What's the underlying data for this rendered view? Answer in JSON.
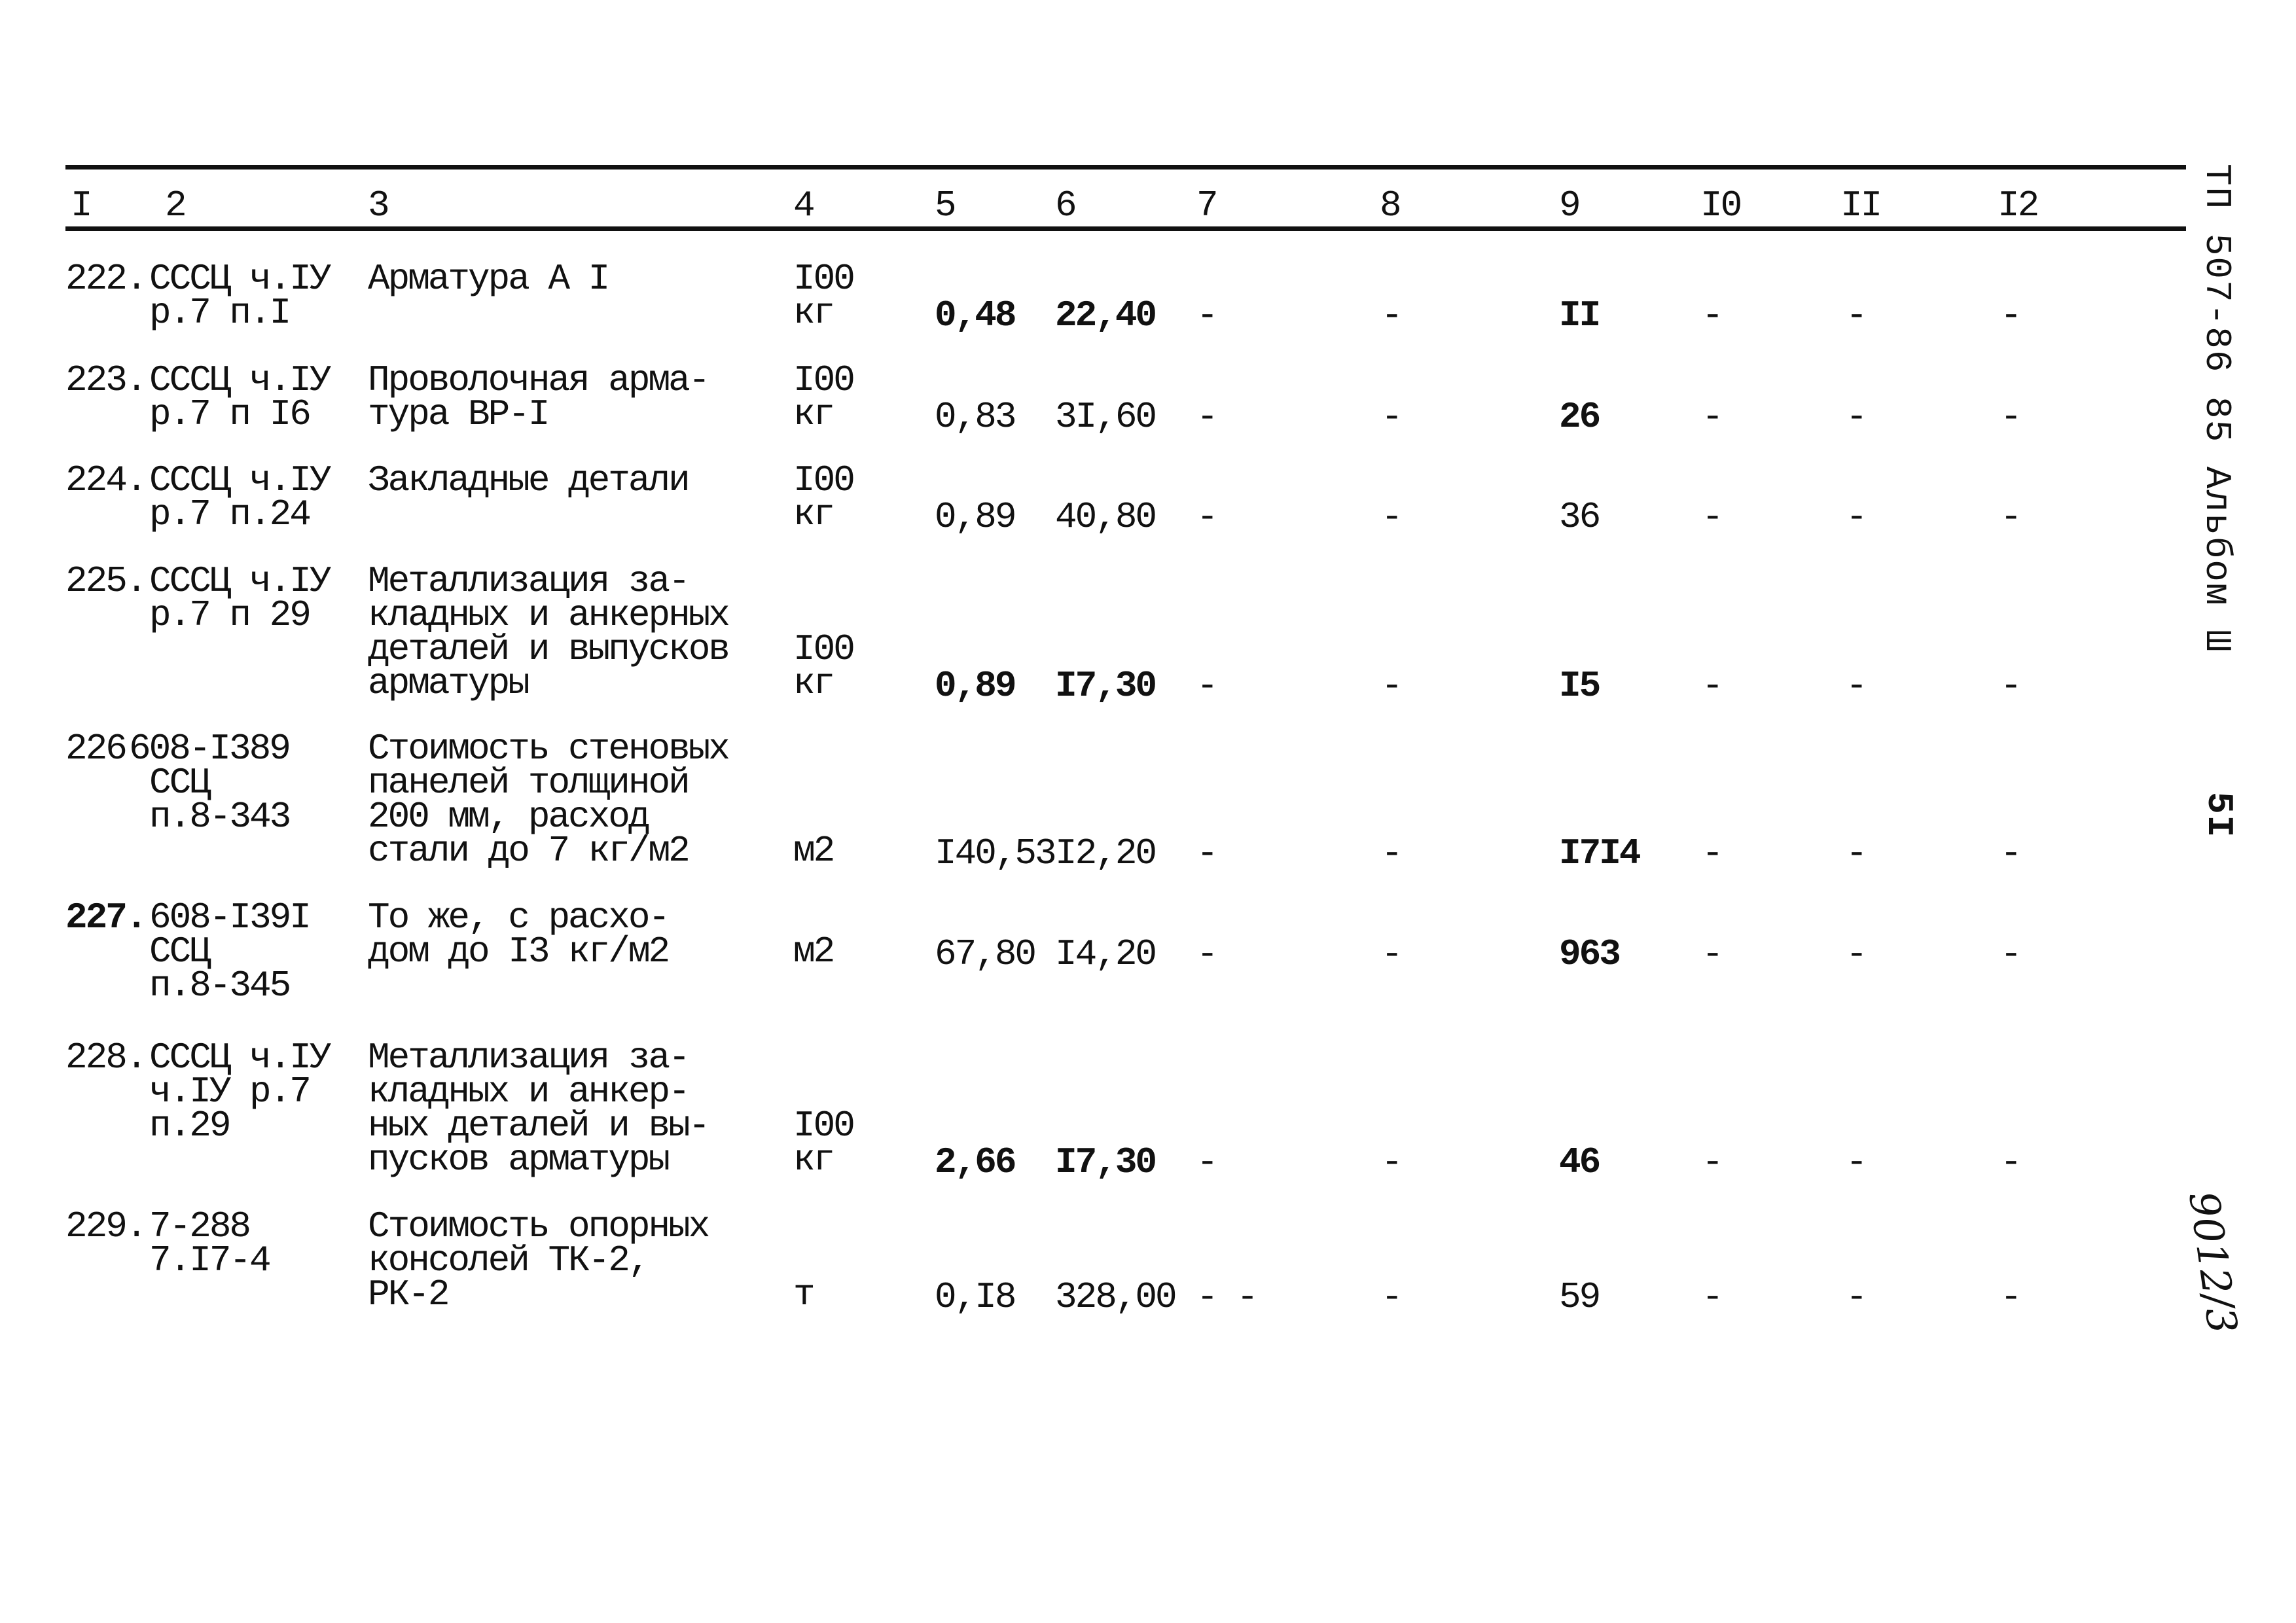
{
  "document": {
    "side_title": "ТП 507-86 85 Альбом Ш",
    "page_number": "5I",
    "handwritten_note": "9012/3"
  },
  "table": {
    "column_headers": [
      "I",
      "2",
      "3",
      "4",
      "5",
      "6",
      "7",
      "8",
      "9",
      "I0",
      "II",
      "I2"
    ],
    "rows": [
      {
        "num": "222.",
        "ref": [
          "СССЦ ч.IУ",
          "р.7 п.I"
        ],
        "desc": [
          "Арматура А I"
        ],
        "unit": [
          "I00",
          "кг"
        ],
        "c5": "0,48",
        "c6": "22,40",
        "c7": "-",
        "c8": "-",
        "c9": "II",
        "c10": "-",
        "c11": "-",
        "c12": "-"
      },
      {
        "num": "223.",
        "ref": [
          "СССЦ ч.IУ",
          "р.7 п I6"
        ],
        "desc": [
          "Проволочная арма-",
          "тура ВР-I"
        ],
        "unit": [
          "I00",
          "кг"
        ],
        "c5": "0,83",
        "c6": "3I,60",
        "c7": "-",
        "c8": "-",
        "c9": "26",
        "c10": "-",
        "c11": "-",
        "c12": "-"
      },
      {
        "num": "224.",
        "ref": [
          "СССЦ ч.IУ",
          "р.7 п.24"
        ],
        "desc": [
          "Закладные детали"
        ],
        "unit": [
          "I00",
          "кг"
        ],
        "c5": "0,89",
        "c6": "40,80",
        "c7": "-",
        "c8": "-",
        "c9": "36",
        "c10": "-",
        "c11": "-",
        "c12": "-"
      },
      {
        "num": "225.",
        "ref": [
          "СССЦ ч.IУ",
          "р.7 п 29"
        ],
        "desc": [
          "Металлизация за-",
          "кладных и анкерных",
          "деталей и выпусков",
          "арматуры"
        ],
        "unit": [
          "I00",
          "кг"
        ],
        "c5": "0,89",
        "c6": "I7,30",
        "c7": "-",
        "c8": "-",
        "c9": "I5",
        "c10": "-",
        "c11": "-",
        "c12": "-"
      },
      {
        "num": "226",
        "ref": [
          "608-I389",
          "ССЦ",
          "п.8-343"
        ],
        "desc": [
          "Стоимость стеновых",
          "панелей толщиной",
          "200 мм, расход",
          "стали до 7 кг/м2"
        ],
        "unit": [
          "м2"
        ],
        "c5": "I40,53",
        "c6": "I2,20",
        "c7": "-",
        "c8": "-",
        "c9": "I7I4",
        "c10": "-",
        "c11": "-",
        "c12": "-"
      },
      {
        "num": "227.",
        "ref": [
          "608-I39I",
          "ССЦ",
          "п.8-345"
        ],
        "desc": [
          "То же, с расхо-",
          "дом до I3 кг/м2"
        ],
        "unit": [
          "м2"
        ],
        "c5": "67,80",
        "c6": "I4,20",
        "c7": "-",
        "c8": "-",
        "c9": "963",
        "c10": "-",
        "c11": "-",
        "c12": "-"
      },
      {
        "num": "228.",
        "ref": [
          "СССЦ ч.IУ",
          "ч.IУ р.7",
          "п.29"
        ],
        "desc": [
          "Металлизация за-",
          "кладных и анкер-",
          "ных деталей и вы-",
          "пусков арматуры"
        ],
        "unit": [
          "I00",
          "кг"
        ],
        "c5": "2,66",
        "c6": "I7,30",
        "c7": "-",
        "c8": "-",
        "c9": "46",
        "c10": "-",
        "c11": "-",
        "c12": "-"
      },
      {
        "num": "229.",
        "ref": [
          "7-288",
          "7.I7-4"
        ],
        "desc": [
          "Стоимость опорных",
          "консолей ТК-2,",
          "РК-2"
        ],
        "unit": [
          "т"
        ],
        "c5": "0,I8",
        "c6": "328,00",
        "c7": "- -",
        "c8": "-",
        "c9": "59",
        "c10": "-",
        "c11": "-",
        "c12": "-"
      }
    ]
  }
}
